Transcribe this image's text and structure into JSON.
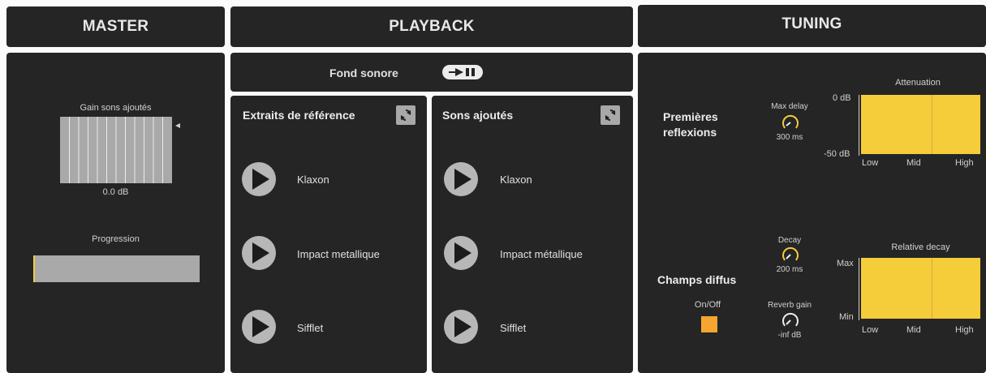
{
  "headers": {
    "master": "MASTER",
    "playback": "PLAYBACK",
    "tuning": "TUNING"
  },
  "master": {
    "gain_label": "Gain sons ajoutés",
    "gain_value": "0.0 dB",
    "progress_label": "Progression",
    "progress_fraction": 0.0
  },
  "playback": {
    "fond_sonore_label": "Fond sonore",
    "reference": {
      "title": "Extraits de référence",
      "items": [
        {
          "label": "Klaxon"
        },
        {
          "label": "Impact metallique"
        },
        {
          "label": "Sifflet"
        }
      ]
    },
    "added": {
      "title": "Sons ajoutés",
      "items": [
        {
          "label": "Klaxon"
        },
        {
          "label": "Impact métallique"
        },
        {
          "label": "Sifflet"
        }
      ]
    }
  },
  "tuning": {
    "early": {
      "title_line1": "Premières",
      "title_line2": "reflexions",
      "max_delay_label": "Max delay",
      "max_delay_value": "300 ms",
      "graph_title": "Attenuation",
      "y_top": "0 dB",
      "y_bottom": "-50 dB",
      "x_labels": [
        "Low",
        "Mid",
        "High"
      ]
    },
    "diffuse": {
      "title": "Champs diffus",
      "onoff_label": "On/Off",
      "decay_label": "Decay",
      "decay_value": "200 ms",
      "reverb_gain_label": "Reverb gain",
      "reverb_gain_value": "-inf dB",
      "graph_title": "Relative decay",
      "y_top": "Max",
      "y_bottom": "Min",
      "x_labels": [
        "Low",
        "Mid",
        "High"
      ]
    }
  },
  "colors": {
    "accent_yellow": "#f5cc3a",
    "orange_toggle": "#f7a531",
    "panel": "#252525"
  }
}
